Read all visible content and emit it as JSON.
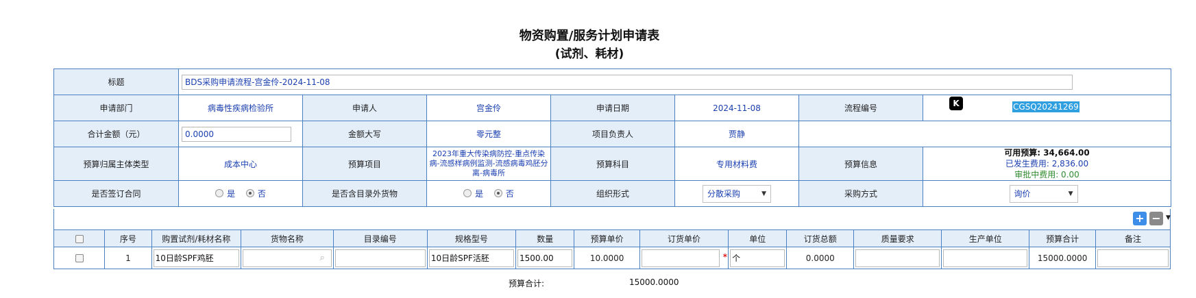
{
  "page": {
    "title_line1": "物资购置/服务计划申请表",
    "title_line2": "(试剂、耗材)"
  },
  "form": {
    "subject_label": "标题",
    "subject_value": "BDS采购申请流程-宫金伶-2024-11-08",
    "dept_label": "申请部门",
    "dept_value": "病毒性疾病检验所",
    "applicant_label": "申请人",
    "applicant_value": "宫金伶",
    "date_label": "申请日期",
    "date_value": "2024-11-08",
    "process_no_label": "流程编号",
    "process_no_value": "CGSQ20241269",
    "total_label": "合计金额（元）",
    "total_value": "0.0000",
    "amount_cn_label": "金额大写",
    "amount_cn_value": "零元整",
    "project_owner_label": "项目负责人",
    "project_owner_value": "贾静",
    "budget_type_label": "预算归属主体类型",
    "budget_type_value": "成本中心",
    "budget_item_label": "预算项目",
    "budget_item_value": "2023年重大传染病防控-重点传染病-流感样病例监测-流感病毒鸡胚分离-病毒所",
    "budget_subject_label": "预算科目",
    "budget_subject_value": "专用材料费",
    "budget_info_label": "预算信息",
    "budget_available": "可用预算:  34,664.00",
    "budget_spent": "已发生费用:  2,836.00",
    "budget_pending": "审批中费用:  0.00",
    "contract_label": "是否签订合同",
    "contract_yes": "是",
    "contract_no": "否",
    "catalog_label": "是否含目录外货物",
    "catalog_yes": "是",
    "catalog_no": "否",
    "org_form_label": "组织形式",
    "org_form_value": "分散采购",
    "purchase_method_label": "采购方式",
    "purchase_method_value": "询价"
  },
  "grid": {
    "headers": [
      "序号",
      "购置试剂/耗材名称",
      "货物名称",
      "目录编号",
      "规格型号",
      "数量",
      "预算单价",
      "订货单价",
      "单位",
      "订货总额",
      "质量要求",
      "生产单位",
      "预算合计",
      "备注"
    ],
    "rows": [
      {
        "index": "1",
        "name": "10日龄SPF鸡胚",
        "goods": "",
        "catalog_no": "",
        "spec": "10日龄SPF活胚",
        "qty": "1500.00",
        "budget_price": "10.0000",
        "order_price": "",
        "unit": "个",
        "order_total": "0.0000",
        "quality": "",
        "producer": "",
        "budget_total": "15000.0000",
        "note": ""
      }
    ]
  },
  "summary": {
    "label": "预算合计:",
    "value": "15000.0000"
  },
  "colors": {
    "border": "#4a7fc1",
    "label_bg": "#e4eef9",
    "value_text": "#1a3fb0",
    "highlight": "#2f9fe0"
  }
}
